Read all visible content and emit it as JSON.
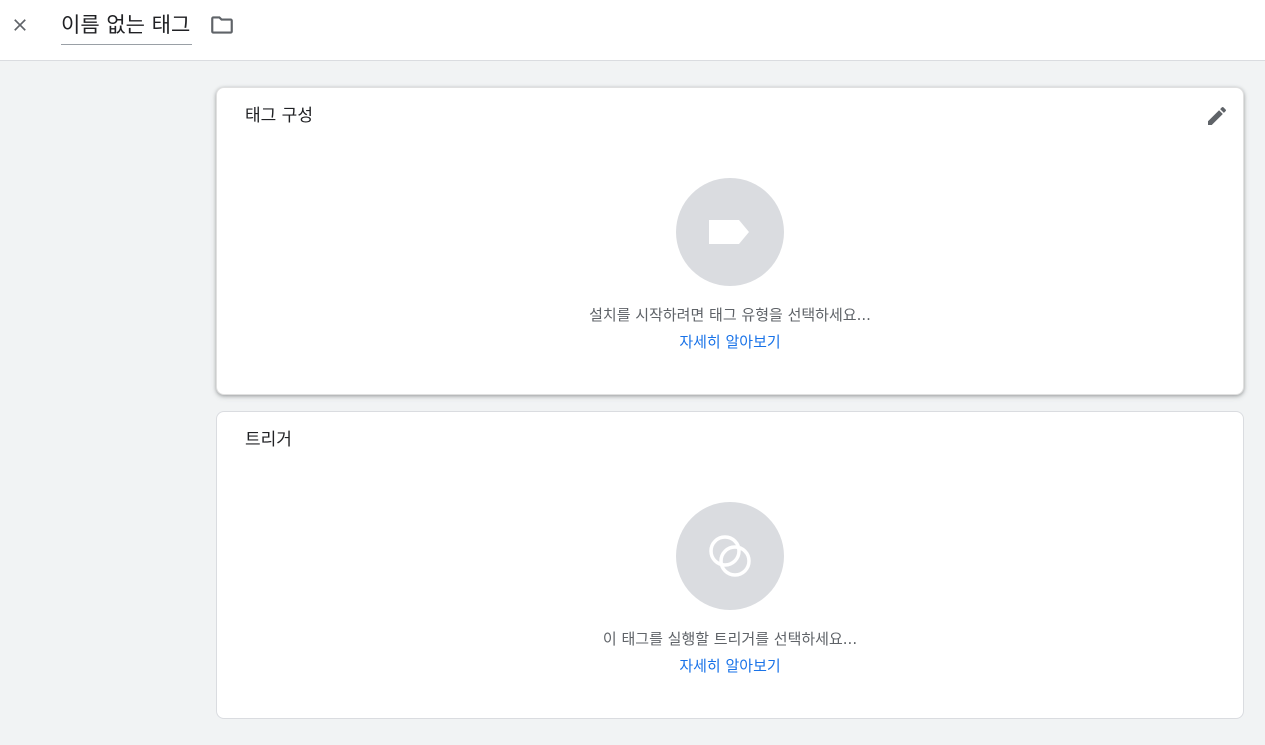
{
  "header": {
    "title": "이름 없는 태그",
    "close_icon": "close-icon",
    "folder_icon": "folder-icon"
  },
  "tag_config": {
    "title": "태그 구성",
    "edit_icon": "pencil-icon",
    "placeholder_icon": "tag-icon",
    "hint": "설치를 시작하려면 태그 유형을 선택하세요...",
    "learn_more": "자세히 알아보기"
  },
  "triggers": {
    "title": "트리거",
    "placeholder_icon": "trigger-icon",
    "hint": "이 태그를 실행할 트리거를 선택하세요...",
    "learn_more": "자세히 알아보기"
  },
  "colors": {
    "background": "#f1f3f4",
    "card": "#ffffff",
    "icon_circle": "#dadce0",
    "link": "#1a73e8",
    "secondary_text": "#5f6368",
    "icon": "#5f6368"
  }
}
